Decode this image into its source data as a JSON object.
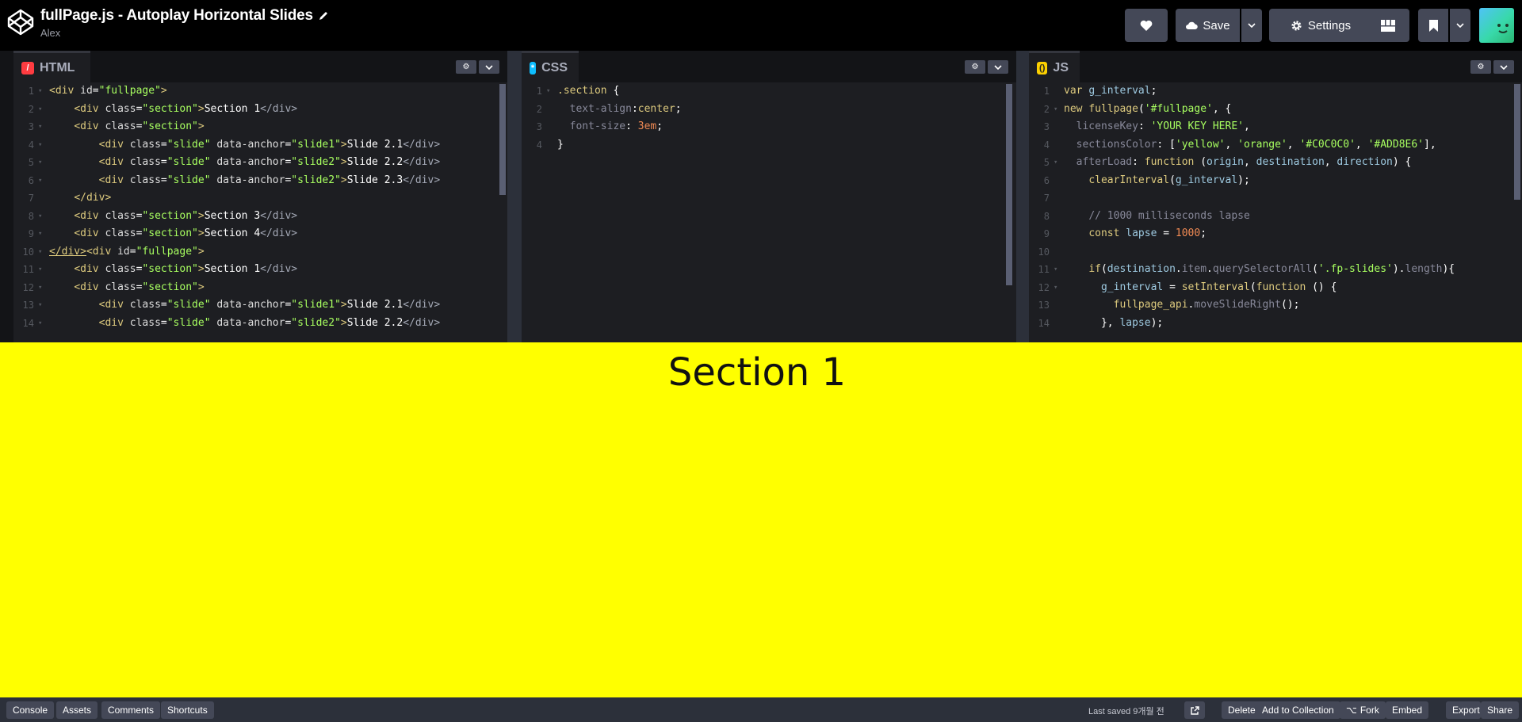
{
  "header": {
    "title": "fullPage.js - Autoplay Horizontal Slides",
    "author": "Alex",
    "save_label": "Save",
    "settings_label": "Settings"
  },
  "editors": {
    "html": {
      "tab_label": "HTML",
      "icon": "html-icon"
    },
    "css": {
      "tab_label": "CSS",
      "icon": "css-icon"
    },
    "js": {
      "tab_label": "JS",
      "icon": "js-icon"
    }
  },
  "preview": {
    "text": "Section 1",
    "background": "#ffff00"
  },
  "footer": {
    "left_buttons": [
      "Console",
      "Assets",
      "Comments",
      "Shortcuts"
    ],
    "status": "Last saved 9개월 전",
    "delete": "Delete",
    "add_to_collection": "Add to Collection",
    "fork": "Fork",
    "embed": "Embed",
    "export": "Export",
    "share": "Share"
  },
  "colors": {
    "accent_html": "#ff3c41",
    "accent_css": "#0ebeff",
    "accent_js": "#fcd000"
  }
}
